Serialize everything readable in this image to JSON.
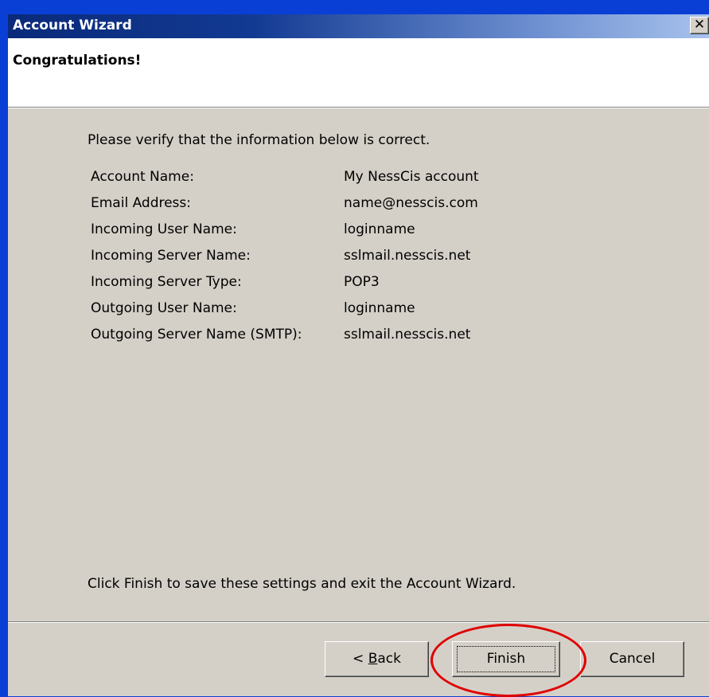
{
  "window": {
    "title": "Account Wizard",
    "close_glyph": "✕"
  },
  "header": {
    "heading": "Congratulations!"
  },
  "main": {
    "intro": "Please verify that the information below is correct.",
    "rows": [
      {
        "label": "Account Name:",
        "value": "My NessCis account"
      },
      {
        "label": "Email Address:",
        "value": "name@nesscis.com"
      },
      {
        "label": "Incoming User Name:",
        "value": "loginname"
      },
      {
        "label": "Incoming Server Name:",
        "value": "sslmail.nesscis.net"
      },
      {
        "label": "Incoming Server Type:",
        "value": "POP3"
      },
      {
        "label": "Outgoing User Name:",
        "value": "loginname"
      },
      {
        "label": "Outgoing Server Name (SMTP):",
        "value": "sslmail.nesscis.net"
      }
    ],
    "footer_text": "Click Finish to save these settings and exit the Account Wizard."
  },
  "buttons": {
    "back_prefix": "< ",
    "back_accel": "B",
    "back_rest": "ack",
    "finish": "Finish",
    "cancel": "Cancel"
  },
  "colors": {
    "desktop": "#0a3fd6",
    "dialog_face": "#d4d0c8",
    "highlight": "#e00000"
  },
  "icons": {
    "close": "close-icon"
  }
}
